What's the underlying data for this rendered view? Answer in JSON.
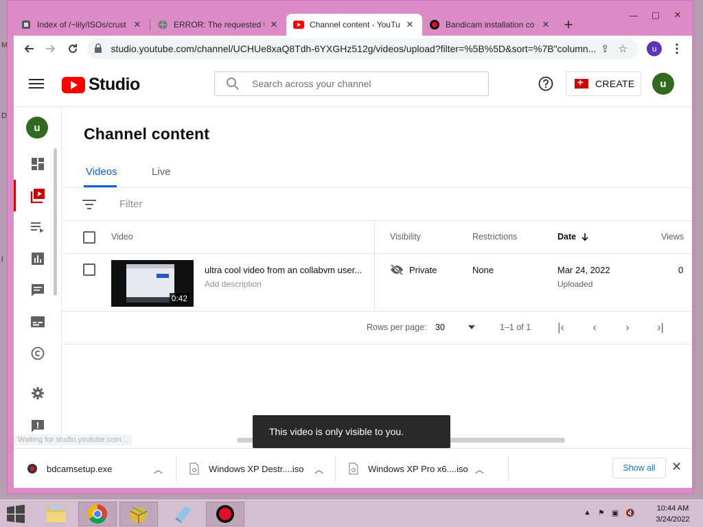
{
  "browser": {
    "tabs": [
      {
        "title": "Index of /~lily/ISOs/crust",
        "favicon": "site-icon",
        "active": false
      },
      {
        "title": "ERROR: The requested UR",
        "favicon": "globe-icon",
        "active": false
      },
      {
        "title": "Channel content - YouTu",
        "favicon": "youtube-icon",
        "active": true
      },
      {
        "title": "Bandicam installation co",
        "favicon": "bandicam-icon",
        "active": false
      }
    ],
    "new_tab": "+",
    "url": "studio.youtube.com/channel/UCHUe8xaQ8Tdh-6YXGHz512g/videos/upload?filter=%5B%5D&sort=%7B\"column...",
    "profile_initial": "u",
    "window_controls": {
      "minimize": "—",
      "restore": "▢",
      "close": "✕"
    }
  },
  "studio": {
    "logo_text": "Studio",
    "search_placeholder": "Search across your channel",
    "create_label": "CREATE",
    "avatar_initial": "u",
    "page_title": "Channel content",
    "tabs": [
      {
        "label": "Videos",
        "active": true
      },
      {
        "label": "Live",
        "active": false
      }
    ],
    "filter_label": "Filter",
    "columns": {
      "video": "Video",
      "visibility": "Visibility",
      "restrictions": "Restrictions",
      "date": "Date",
      "views": "Views"
    },
    "rows": [
      {
        "title": "ultra cool video from an collabvm user...",
        "description": "Add description",
        "duration": "0:42",
        "visibility": "Private",
        "restrictions": "None",
        "date": "Mar 24, 2022",
        "date_status": "Uploaded",
        "views": "0"
      }
    ],
    "pagination": {
      "rows_per_page_label": "Rows per page:",
      "rows_per_page": "30",
      "range": "1–1 of 1"
    },
    "toast": "This video is only visible to you.",
    "status_text": "Waiting for studio.youtube.com..."
  },
  "downloads": {
    "items": [
      {
        "name": "bdcamsetup.exe",
        "icon": "bandicam-file-icon"
      },
      {
        "name": "Windows XP Destr....iso",
        "icon": "iso-file-icon"
      },
      {
        "name": "Windows XP Pro x6....iso",
        "icon": "iso-file-icon"
      }
    ],
    "show_all": "Show all"
  },
  "taskbar": {
    "time": "10:44 AM",
    "date": "3/24/2022",
    "apps": [
      "file-explorer-icon",
      "chrome-icon",
      "package-icon",
      "notepad-icon",
      "record-icon"
    ]
  },
  "colors": {
    "accent_blue": "#065fd4",
    "youtube_red": "#ff0000",
    "avatar_green": "#33691e",
    "window_frame": "#dc8bc6"
  }
}
